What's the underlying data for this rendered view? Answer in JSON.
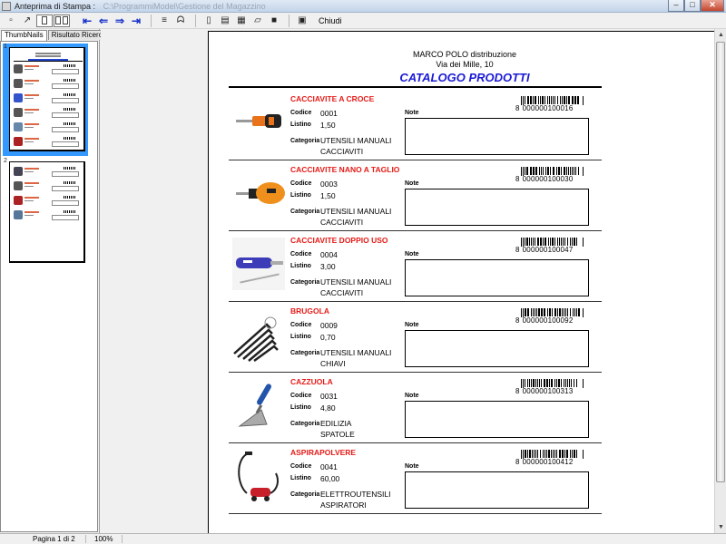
{
  "window": {
    "title": "Anteprima di Stampa :",
    "subtitle": "C:\\ProgrammiModel\\Gestione del Magazzino",
    "controls": [
      "minimize-icon",
      "maximize-icon",
      "close-icon"
    ]
  },
  "toolbar": {
    "close_label": "Chiudi",
    "buttons": [
      "zoom-in-icon",
      "cursor-icon",
      "single-page-icon",
      "two-pages-icon",
      "first-page-icon",
      "previous-page-icon",
      "next-page-icon",
      "last-page-icon",
      "find-icon",
      "binoculars-icon",
      "new-document-icon",
      "export-icon",
      "print-icon",
      "open-folder-icon",
      "save-icon",
      "exit-icon"
    ]
  },
  "left_panel": {
    "tabs": [
      {
        "label": "ThumbNails",
        "active": true
      },
      {
        "label": "Risultato Ricerca",
        "active": false
      }
    ],
    "thumbnails": [
      {
        "number": "1",
        "selected": true
      },
      {
        "number": "2",
        "selected": false
      }
    ]
  },
  "document": {
    "company": "MARCO POLO distribuzione",
    "address": "Via dei Mille, 10",
    "title": "CATALOGO PRODOTTI",
    "labels": {
      "code": "Codice",
      "price": "Listino",
      "category": "Categoria",
      "notes": "Note"
    },
    "products": [
      {
        "name": "CACCIAVITE A CROCE",
        "code": "0001",
        "price": "1,50",
        "category": "UTENSILI MANUALI",
        "subcategory": "CACCIAVITI",
        "barcode_lead": "8",
        "barcode_left": "000000",
        "barcode_right": "10001",
        "barcode_check": "6",
        "image": "screwdriver-icon"
      },
      {
        "name": "CACCIAVITE NANO A TAGLIO",
        "code": "0003",
        "price": "1,50",
        "category": "UTENSILI MANUALI",
        "subcategory": "CACCIAVITI",
        "barcode_lead": "8",
        "barcode_left": "000000",
        "barcode_right": "10003",
        "barcode_check": "0",
        "image": "stubby-screwdriver-icon"
      },
      {
        "name": "CACCIAVITE DOPPIO USO",
        "code": "0004",
        "price": "3,00",
        "category": "UTENSILI MANUALI",
        "subcategory": "CACCIAVITI",
        "barcode_lead": "8",
        "barcode_left": "000000",
        "barcode_right": "10004",
        "barcode_check": "7",
        "image": "dual-screwdriver-icon"
      },
      {
        "name": "BRUGOLA",
        "code": "0009",
        "price": "0,70",
        "category": "UTENSILI MANUALI",
        "subcategory": "CHIAVI",
        "barcode_lead": "8",
        "barcode_left": "000000",
        "barcode_right": "10009",
        "barcode_check": "2",
        "image": "hex-key-set-icon"
      },
      {
        "name": "CAZZUOLA",
        "code": "0031",
        "price": "4,80",
        "category": "EDILIZIA",
        "subcategory": "SPATOLE",
        "barcode_lead": "8",
        "barcode_left": "000000",
        "barcode_right": "10031",
        "barcode_check": "3",
        "image": "trowel-icon"
      },
      {
        "name": "ASPIRAPOLVERE",
        "code": "0041",
        "price": "60,00",
        "category": "ELETTROUTENSILI",
        "subcategory": "ASPIRATORI",
        "barcode_lead": "8",
        "barcode_left": "000000",
        "barcode_right": "10041",
        "barcode_check": "2",
        "image": "vacuum-cleaner-icon"
      }
    ]
  },
  "status": {
    "page": "Pagina 1 di 2",
    "zoom": "100%"
  }
}
